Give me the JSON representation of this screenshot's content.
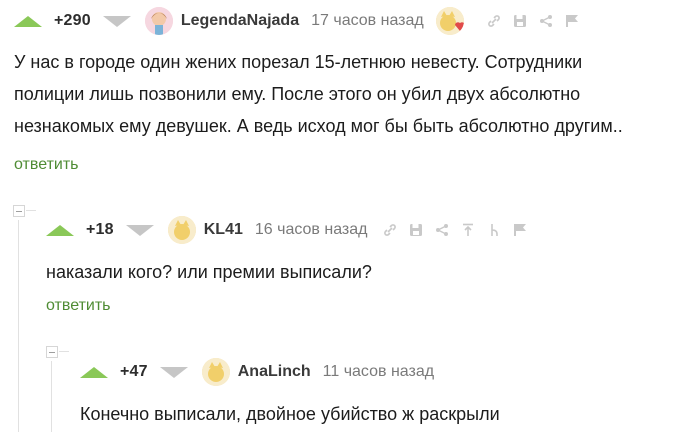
{
  "comments": [
    {
      "rating": "+290",
      "username": "LegendaNajada",
      "time": "17 часов назад",
      "text_lines": [
        "У нас в городе один жених порезал 15-летнюю невесту. Сотрудники",
        "полиции лишь позвонили ему. После этого он убил двух абсолютно",
        "незнакомых ему девушек. А ведь исход мог бы быть абсолютно другим.."
      ],
      "reply_label": "ответить"
    },
    {
      "rating": "+18",
      "username": "KL41",
      "time": "16 часов назад",
      "text": "наказали кого? или премии выписали?",
      "reply_label": "ответить"
    },
    {
      "rating": "+47",
      "username": "AnaLinch",
      "time": "11 часов назад",
      "text": "Конечно выписали, двойное убийство ж раскрыли"
    }
  ],
  "colors": {
    "upvote": "#8ac858",
    "downvote": "#c6c6c6",
    "reply": "#4f8c34",
    "time": "#7a7a7a"
  },
  "icons": [
    "arrow-up-icon",
    "arrow-down-icon",
    "link-icon",
    "save-icon",
    "share-icon",
    "flag-icon",
    "to-parent-icon",
    "to-branch-icon"
  ]
}
